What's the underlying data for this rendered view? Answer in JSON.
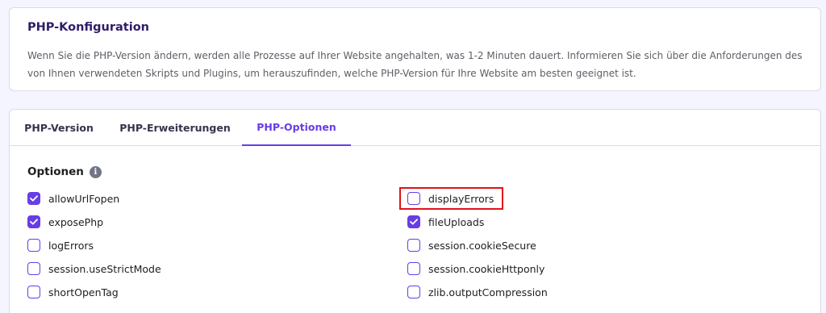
{
  "info": {
    "title": "PHP-Konfiguration",
    "text": "Wenn Sie die PHP-Version ändern, werden alle Prozesse auf Ihrer Website angehalten, was 1-2 Minuten dauert. Informieren Sie sich über die Anforderungen des von Ihnen verwendeten Skripts und Plugins, um herauszufinden, welche PHP-Version für Ihre Website am besten geeignet ist."
  },
  "tabs": [
    {
      "label": "PHP-Version",
      "active": false
    },
    {
      "label": "PHP-Erweiterungen",
      "active": false
    },
    {
      "label": "PHP-Optionen",
      "active": true
    }
  ],
  "options": {
    "heading": "Optionen",
    "info_icon": "info-icon",
    "left": [
      {
        "label": "allowUrlFopen",
        "checked": true
      },
      {
        "label": "exposePhp",
        "checked": true
      },
      {
        "label": "logErrors",
        "checked": false
      },
      {
        "label": "session.useStrictMode",
        "checked": false
      },
      {
        "label": "shortOpenTag",
        "checked": false
      }
    ],
    "right": [
      {
        "label": "displayErrors",
        "checked": false
      },
      {
        "label": "fileUploads",
        "checked": true
      },
      {
        "label": "session.cookieSecure",
        "checked": false
      },
      {
        "label": "session.cookieHttponly",
        "checked": false
      },
      {
        "label": "zlib.outputCompression",
        "checked": false
      }
    ]
  },
  "colors": {
    "accent": "#673de6",
    "highlight": "#e0121b",
    "background": "#f4f5ff"
  }
}
